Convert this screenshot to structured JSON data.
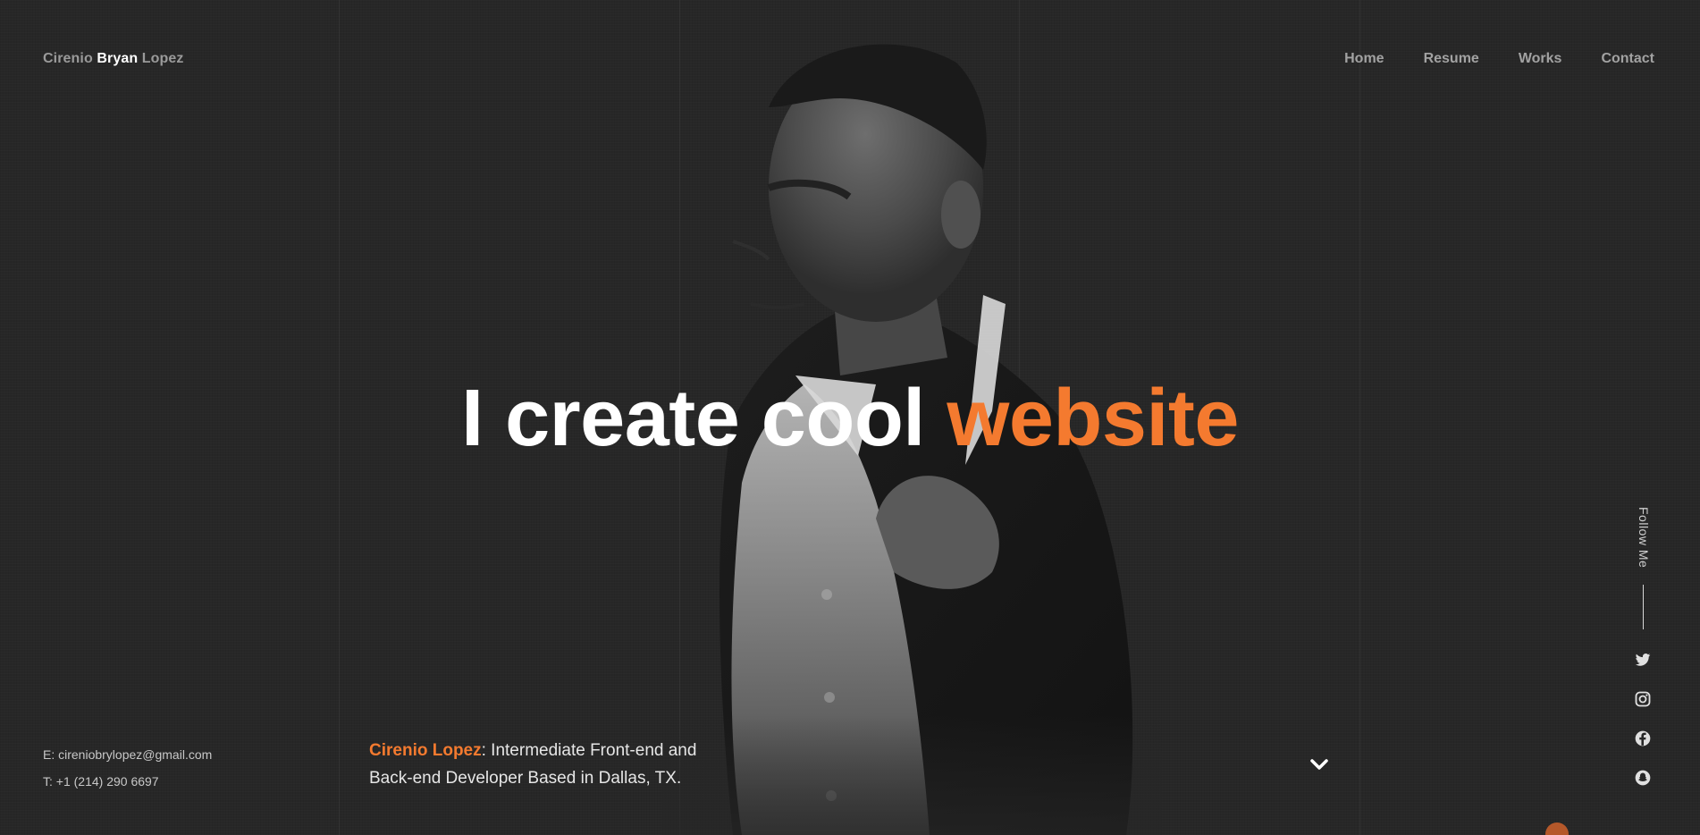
{
  "header": {
    "logo_first": "Cirenio",
    "logo_middle": "Bryan",
    "logo_last": "Lopez",
    "nav": [
      "Home",
      "Resume",
      "Works",
      "Contact"
    ]
  },
  "hero": {
    "text": "I create cool",
    "accent": "website"
  },
  "contact": {
    "email": "E: cireniobrylopez@gmail.com",
    "phone": "T: +1 (214) 290 6697"
  },
  "bio": {
    "name": "Cirenio Lopez",
    "text": ": Intermediate Front-end and Back-end Developer Based in Dallas, TX."
  },
  "follow": {
    "label": "Follow Me",
    "icons": [
      "twitter-icon",
      "instagram-icon",
      "facebook-icon",
      "snapchat-icon"
    ]
  },
  "colors": {
    "accent": "#f47a2f",
    "background": "#272727",
    "nav_text": "#a2a2a2"
  }
}
